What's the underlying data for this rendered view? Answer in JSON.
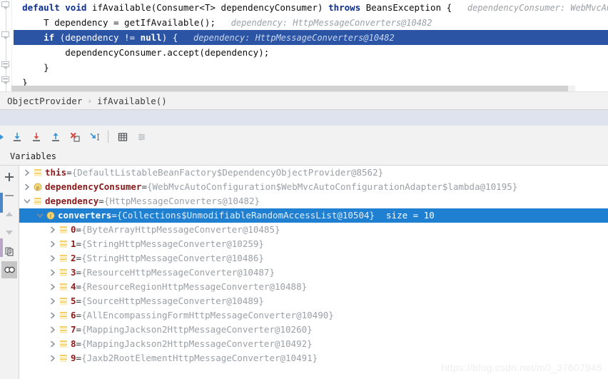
{
  "editor": {
    "lines": [
      {
        "indent": 0,
        "segments": [
          {
            "t": "kw",
            "v": "default "
          },
          {
            "t": "kw",
            "v": "void "
          },
          {
            "t": "p",
            "v": "ifAvailable(Consumer<T> dependencyConsumer) "
          },
          {
            "t": "kw",
            "v": "throws "
          },
          {
            "t": "p",
            "v": "BeansException {"
          }
        ],
        "hint_label": "dependencyConsumer:",
        "hint_value": "WebMvcAutoConf",
        "selected": false
      },
      {
        "indent": 1,
        "segments": [
          {
            "t": "p",
            "v": "T dependency = getIfAvailable();"
          }
        ],
        "hint_label": "dependency:",
        "hint_value": "HttpMessageConverters@10482",
        "selected": false
      },
      {
        "indent": 1,
        "segments": [
          {
            "t": "kw",
            "v": "if "
          },
          {
            "t": "p",
            "v": "(dependency != "
          },
          {
            "t": "kw",
            "v": "null"
          },
          {
            "t": "p",
            "v": ") {"
          }
        ],
        "hint_label": "dependency:",
        "hint_value": "HttpMessageConverters@10482",
        "selected": true
      },
      {
        "indent": 2,
        "segments": [
          {
            "t": "p",
            "v": "dependencyConsumer.accept(dependency);"
          }
        ],
        "hint_label": "",
        "hint_value": "",
        "selected": false
      },
      {
        "indent": 1,
        "segments": [
          {
            "t": "p",
            "v": "}"
          }
        ],
        "hint_label": "",
        "hint_value": "",
        "selected": false
      },
      {
        "indent": 0,
        "segments": [
          {
            "t": "p",
            "v": "}"
          }
        ],
        "hint_label": "",
        "hint_value": "",
        "selected": false
      }
    ]
  },
  "breadcrumb": {
    "items": [
      "ObjectProvider",
      "ifAvailable()"
    ],
    "separator": "›"
  },
  "toolbar": {
    "buttons": [
      {
        "name": "show-execution-point-icon",
        "label": "Show Execution Point"
      },
      {
        "name": "step-over-icon",
        "label": "Step Over"
      },
      {
        "name": "step-into-icon",
        "label": "Step Into"
      },
      {
        "name": "step-out-icon",
        "label": "Step Out"
      },
      {
        "name": "force-step-into-icon",
        "label": "Force Step Into"
      },
      {
        "name": "run-to-cursor-icon",
        "label": "Run to Cursor"
      },
      {
        "name": "evaluate-expression-icon",
        "label": "Evaluate Expression"
      },
      {
        "name": "filter-icon",
        "label": "Settings"
      }
    ]
  },
  "variables_panel": {
    "title": "Variables",
    "rail_buttons": [
      {
        "name": "add-watch-button",
        "label": "+"
      },
      {
        "name": "remove-watch-button",
        "label": "−"
      },
      {
        "name": "move-up-button",
        "label": "Up"
      },
      {
        "name": "move-down-button",
        "label": "Down"
      },
      {
        "name": "copy-button",
        "label": "Copy"
      },
      {
        "name": "watches-button",
        "label": "Watches"
      }
    ],
    "rows": [
      {
        "depth": 0,
        "expander": "collapsed",
        "icon": "field-icon",
        "name": "this",
        "eq": " = ",
        "value": "{DefaultListableBeanFactory$DependencyObjectProvider@8562}",
        "size": "",
        "selected": false
      },
      {
        "depth": 0,
        "expander": "collapsed",
        "icon": "parameter-icon",
        "name": "dependencyConsumer",
        "eq": " = ",
        "value": "{WebMvcAutoConfiguration$WebMvcAutoConfigurationAdapter$lambda@10195}",
        "size": "",
        "selected": false
      },
      {
        "depth": 0,
        "expander": "expanded",
        "icon": "field-icon",
        "name": "dependency",
        "eq": " = ",
        "value": "{HttpMessageConverters@10482}",
        "size": "",
        "selected": false
      },
      {
        "depth": 1,
        "expander": "expanded",
        "icon": "field-f-icon",
        "name": "converters",
        "eq": " = ",
        "value": "{Collections$UnmodifiableRandomAccessList@10504}",
        "size": "size = 10",
        "selected": true
      },
      {
        "depth": 2,
        "expander": "collapsed",
        "icon": "field-icon",
        "name": "0",
        "eq": " = ",
        "value": "{ByteArrayHttpMessageConverter@10485}",
        "size": "",
        "selected": false
      },
      {
        "depth": 2,
        "expander": "collapsed",
        "icon": "field-icon",
        "name": "1",
        "eq": " = ",
        "value": "{StringHttpMessageConverter@10259}",
        "size": "",
        "selected": false
      },
      {
        "depth": 2,
        "expander": "collapsed",
        "icon": "field-icon",
        "name": "2",
        "eq": " = ",
        "value": "{StringHttpMessageConverter@10486}",
        "size": "",
        "selected": false
      },
      {
        "depth": 2,
        "expander": "collapsed",
        "icon": "field-icon",
        "name": "3",
        "eq": " = ",
        "value": "{ResourceHttpMessageConverter@10487}",
        "size": "",
        "selected": false
      },
      {
        "depth": 2,
        "expander": "collapsed",
        "icon": "field-icon",
        "name": "4",
        "eq": " = ",
        "value": "{ResourceRegionHttpMessageConverter@10488}",
        "size": "",
        "selected": false
      },
      {
        "depth": 2,
        "expander": "collapsed",
        "icon": "field-icon",
        "name": "5",
        "eq": " = ",
        "value": "{SourceHttpMessageConverter@10489}",
        "size": "",
        "selected": false
      },
      {
        "depth": 2,
        "expander": "collapsed",
        "icon": "field-icon",
        "name": "6",
        "eq": " = ",
        "value": "{AllEncompassingFormHttpMessageConverter@10490}",
        "size": "",
        "selected": false
      },
      {
        "depth": 2,
        "expander": "collapsed",
        "icon": "field-icon",
        "name": "7",
        "eq": " = ",
        "value": "{MappingJackson2HttpMessageConverter@10260}",
        "size": "",
        "selected": false
      },
      {
        "depth": 2,
        "expander": "collapsed",
        "icon": "field-icon",
        "name": "8",
        "eq": " = ",
        "value": "{MappingJackson2HttpMessageConverter@10492}",
        "size": "",
        "selected": false
      },
      {
        "depth": 2,
        "expander": "collapsed",
        "icon": "field-icon",
        "name": "9",
        "eq": " = ",
        "value": "{Jaxb2RootElementHttpMessageConverter@10491}",
        "size": "",
        "selected": false
      }
    ]
  },
  "watermark": {
    "text": "https://blog.csdn.net/m0_37607945"
  },
  "colors": {
    "selection_blue": "#2b54a4",
    "row_selection_blue": "#1f7fd0",
    "keyword_blue": "#0d2f8f",
    "var_name_red": "#8b1a1a",
    "value_gray": "#9aa0a6",
    "panel_gray": "#f2f2f2",
    "tabbar_blue": "#dfe3ee"
  }
}
